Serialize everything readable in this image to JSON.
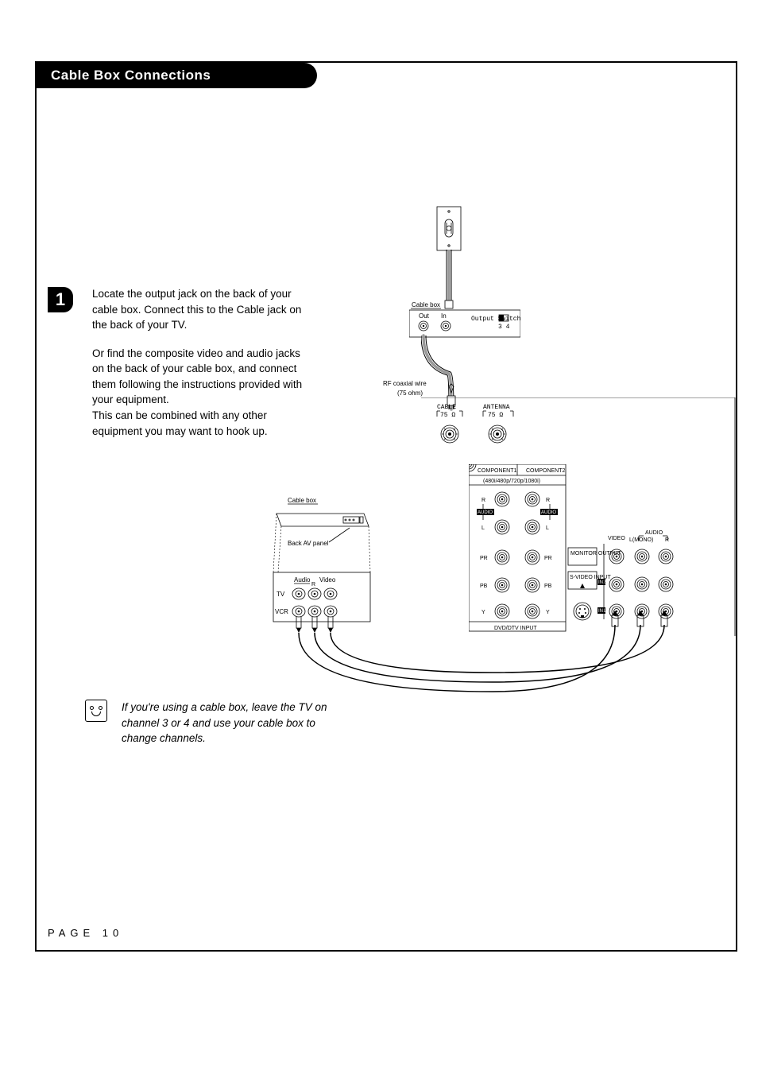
{
  "title": "Cable Box Connections",
  "step_number": "1",
  "paragraphs": {
    "p1": "Locate the output jack on the back of your cable box. Connect this to the Cable jack on the back of your TV.",
    "p2a": "Or find the composite video and audio jacks on the back of your cable box, and connect them following the instructions provided with your equipment.",
    "p2b": "This can be combined with any other equipment you may want to hook up."
  },
  "tip": "If you're using a cable box, leave the TV on channel 3 or 4 and use your cable box to change channels.",
  "page_label": "PAGE 10",
  "diagram": {
    "cable_box_top": {
      "name": "Cable box",
      "out": "Out",
      "in": "In",
      "output_switch": "Output Switch",
      "switch_nums": "3  4"
    },
    "coax_label_a": "RF coaxial wire",
    "coax_label_b": "(75 ohm)",
    "tv_top": {
      "cable": "CABLE",
      "cable_ohm": "75 Ω",
      "antenna": "ANTENNA",
      "antenna_ohm": "75 Ω"
    },
    "components": {
      "c1": "COMPONENT1",
      "c2": "COMPONENT2",
      "res": "(480i/480p/720p/1080i)",
      "r": "R",
      "audio": "AUDIO",
      "l": "L",
      "pr": "PR",
      "pb": "PB",
      "y": "Y",
      "footer": "DVD/DTV INPUT"
    },
    "right_panel": {
      "video": "VIDEO",
      "audio": "AUDIO",
      "lmono": "L(MONO)",
      "r": "R",
      "monitor": "MONITOR OUTPUT",
      "svideo": "S-VIDEO INPUT",
      "in2": "IN2",
      "in1": "IN1"
    },
    "cable_box_left": {
      "name": "Cable box",
      "back_panel": "Back AV panel",
      "audio": "Audio",
      "video": "Video",
      "r": "R",
      "tv": "TV",
      "vcr": "VCR"
    }
  }
}
